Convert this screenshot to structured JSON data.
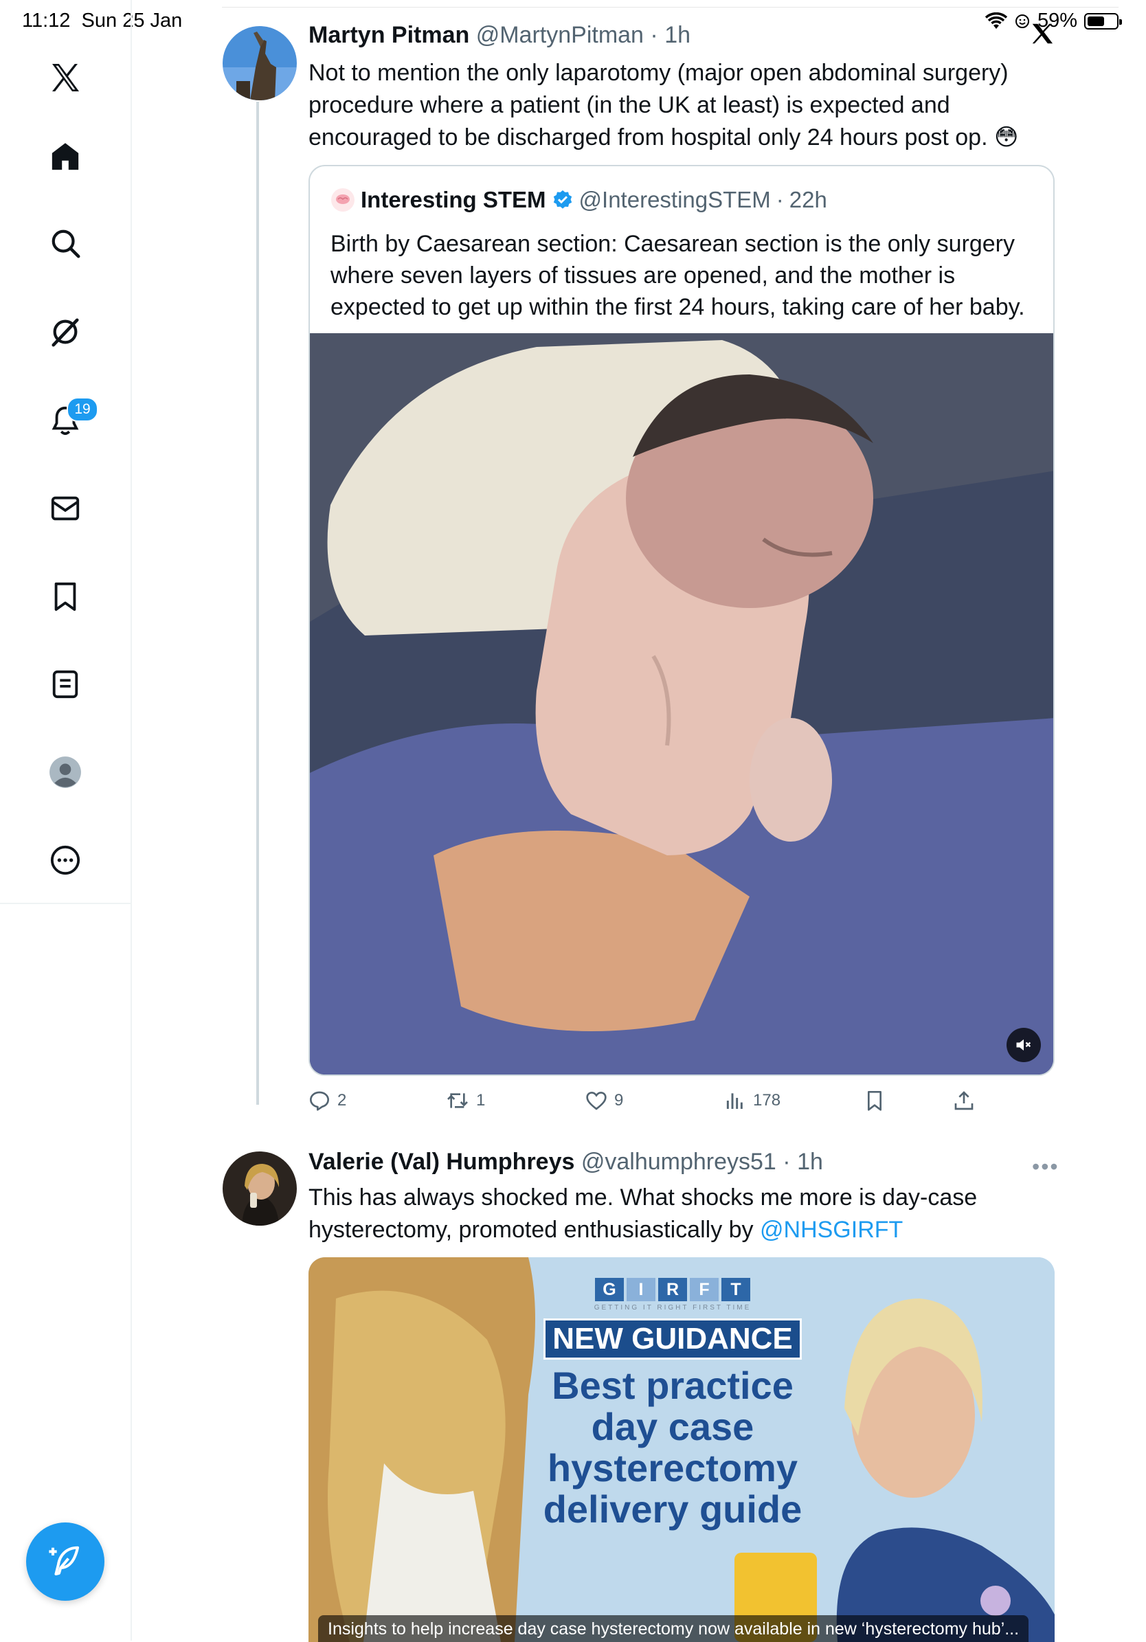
{
  "status_bar": {
    "time": "11:12",
    "date": "Sun 25 Jan",
    "battery": "59%",
    "battery_level": 0.59
  },
  "sidebar": {
    "notification_count": "19",
    "items": [
      "home",
      "search",
      "grok",
      "notifications",
      "messages",
      "bookmarks",
      "lists",
      "profile",
      "more"
    ]
  },
  "tweet1": {
    "name": "Martyn Pitman",
    "handle": "@MartynPitman",
    "time": "1h",
    "text": "Not to mention the only laparotomy (major open abdominal surgery) procedure where a patient (in the UK at least) is expected and encouraged to be discharged from hospital only 24 hours post op. 😳",
    "quote": {
      "name": "Interesting STEM",
      "handle": "@InterestingSTEM",
      "time": "22h",
      "text": "Birth by Caesarean section: Caesarean section is the only surgery where seven layers of tissues are opened, and the mother is expected to get up within the first 24 hours, taking care of her baby."
    },
    "stats": {
      "replies": "2",
      "reposts": "1",
      "likes": "9",
      "views": "178"
    }
  },
  "tweet2": {
    "name": "Valerie (Val) Humphreys",
    "handle": "@valhumphreys51",
    "time": "1h",
    "text_before": "This has always shocked me. What shocks me more is day-case hysterectomy, promoted enthusiastically by ",
    "mention": "@NHSGIRFT",
    "media": {
      "letters": [
        "G",
        "I",
        "R",
        "F",
        "T"
      ],
      "tagline": "GETTING IT RIGHT FIRST TIME",
      "banner": "NEW GUIDANCE",
      "title_lines": [
        "Best practice",
        "day case",
        "hysterectomy",
        "delivery guide"
      ],
      "caption": "Insights to help increase day case hysterectomy now available in new ‘hysterectomy hub’..."
    }
  },
  "colors": {
    "accent": "#1d9bf0",
    "text": "#0f1419",
    "secondary": "#536471",
    "border": "#cfd9de"
  }
}
